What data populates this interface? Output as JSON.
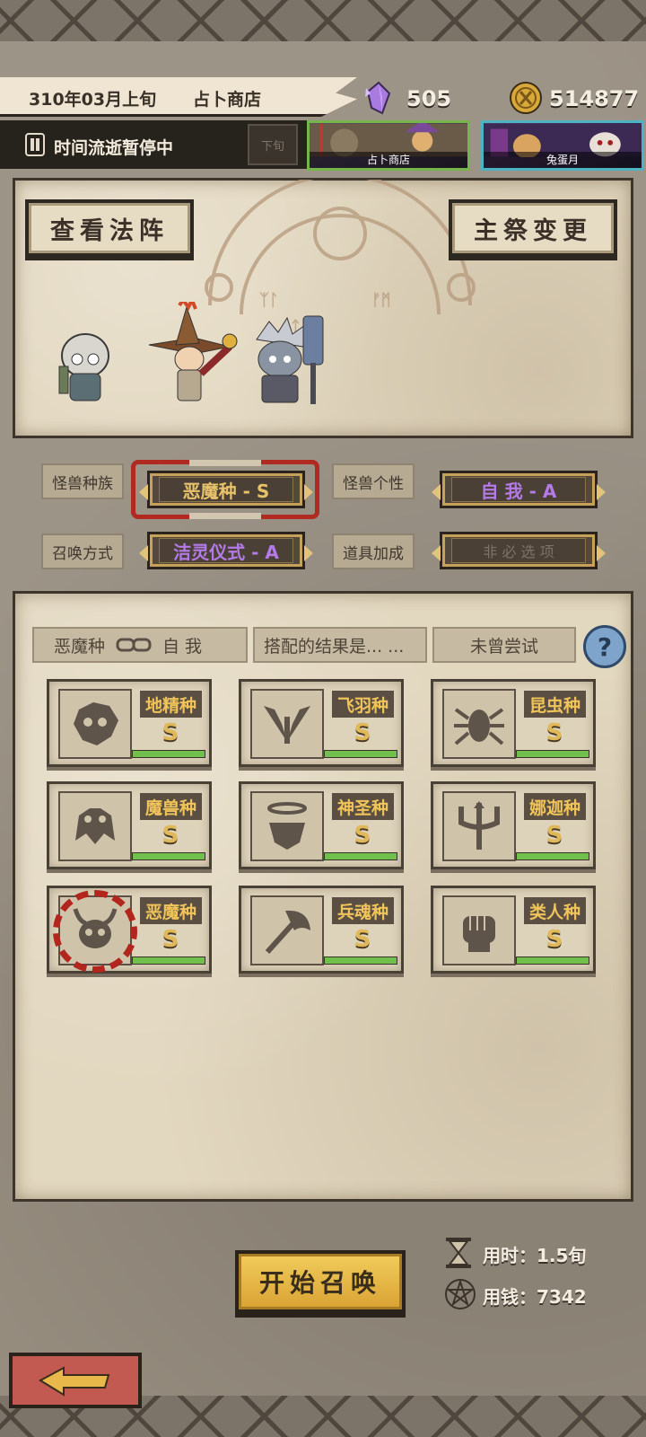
{
  "header": {
    "date": "310年03月上旬",
    "location": "占卜商店",
    "time_status": "时间流逝暂停中",
    "next_button": "下旬",
    "crystals": "505",
    "gold": "514877",
    "location_cards": [
      {
        "label": "占卜商店",
        "active": true
      },
      {
        "label": "兔蛋月",
        "active": false
      }
    ]
  },
  "summon_panel": {
    "view_formation_button": "查看法阵",
    "change_priest_button": "主祭变更"
  },
  "settings": {
    "race_label": "怪兽种族",
    "race_value": "恶魔种 - S",
    "personality_label": "怪兽个性",
    "personality_value": "自 我 - A",
    "method_label": "召唤方式",
    "method_value": "洁灵仪式 - A",
    "item_label": "道具加成",
    "item_value": "非 必 选 项",
    "colors": {
      "race_value": "#e8c26a",
      "personality_value": "#b47ae8",
      "method_value": "#b47ae8",
      "item_value": "#7d7367"
    }
  },
  "combo": {
    "race_tag": "恶魔种",
    "trait_tag": "自 我",
    "result_tag": "搭配的结果是... ...",
    "status_tag": "未曾尝试",
    "help": "?"
  },
  "races": [
    {
      "name": "地精种",
      "grade": "S",
      "icon": "goblin-skull-icon",
      "progress": 1.0,
      "selected": false
    },
    {
      "name": "飞羽种",
      "grade": "S",
      "icon": "wings-icon",
      "progress": 1.0,
      "selected": false
    },
    {
      "name": "昆虫种",
      "grade": "S",
      "icon": "spider-icon",
      "progress": 1.0,
      "selected": false
    },
    {
      "name": "魔兽种",
      "grade": "S",
      "icon": "beast-head-icon",
      "progress": 1.0,
      "selected": false
    },
    {
      "name": "神圣种",
      "grade": "S",
      "icon": "halo-head-icon",
      "progress": 1.0,
      "selected": false
    },
    {
      "name": "娜迦种",
      "grade": "S",
      "icon": "trident-icon",
      "progress": 1.0,
      "selected": false
    },
    {
      "name": "恶魔种",
      "grade": "S",
      "icon": "horned-skull-icon",
      "progress": 1.0,
      "selected": true
    },
    {
      "name": "兵魂种",
      "grade": "S",
      "icon": "axe-icon",
      "progress": 1.0,
      "selected": false
    },
    {
      "name": "类人种",
      "grade": "S",
      "icon": "fist-icon",
      "progress": 1.0,
      "selected": false
    }
  ],
  "footer": {
    "start_button": "开始召唤",
    "time_cost": "用时：1.5旬",
    "money_cost": "用钱：7342"
  }
}
